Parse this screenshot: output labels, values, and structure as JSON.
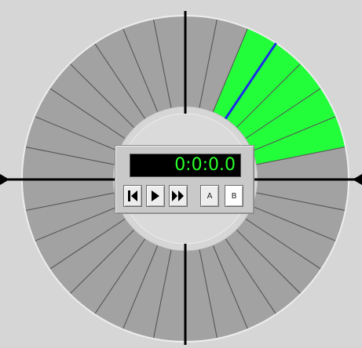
{
  "timer": {
    "display": "0:0:0.0"
  },
  "controls": {
    "rewind_icon": "skip-to-start-icon",
    "play_icon": "play-icon",
    "fast_forward_icon": "fast-forward-icon",
    "a_label": "A",
    "b_label": "B"
  },
  "wheel": {
    "segment_count": 32,
    "highlighted_segments": [
      2,
      3,
      4,
      5,
      6
    ],
    "highlight_color": "#22ff3a",
    "segment_color": "#a2a2a2",
    "playhead_color": "#1a2ee6",
    "position_markers": [
      "top",
      "right",
      "bottom",
      "left"
    ]
  }
}
